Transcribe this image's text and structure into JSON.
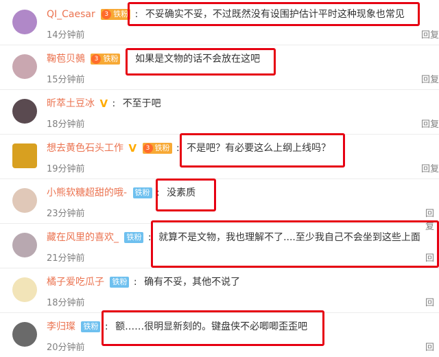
{
  "comments": [
    {
      "user": "QI_Caesar",
      "verified": false,
      "badge": "铁粉",
      "badge_level": "3",
      "badge_style": "gold",
      "text": "不妥确实不妥，不过既然没有设围护估计平时这种现象也常见",
      "time": "14分钟前",
      "reply": "回复",
      "avatar_color": "#b088c8"
    },
    {
      "user": "鞠苞贝鵺",
      "verified": false,
      "badge": "铁粉",
      "badge_level": "3",
      "badge_style": "gold",
      "text": "如果是文物的话不会放在这吧",
      "time": "15分钟前",
      "reply": "回复",
      "avatar_color": "#c9a7b0"
    },
    {
      "user": "昕萃土豆冰",
      "verified": true,
      "badge": "",
      "badge_level": "",
      "badge_style": "",
      "text": "不至于吧",
      "time": "18分钟前",
      "reply": "回复",
      "avatar_color": "#5a4a50"
    },
    {
      "user": "想去黄色石头工作",
      "verified": true,
      "badge": "铁粉",
      "badge_level": "3",
      "badge_style": "gold",
      "text": "不是吧？有必要这么上纲上线吗？",
      "time": "19分钟前",
      "reply": "回复",
      "avatar_color": "#d8a020"
    },
    {
      "user": "小熊软糖超甜的哦-",
      "verified": false,
      "badge": "铁粉",
      "badge_level": "",
      "badge_style": "blue",
      "text": "没素质",
      "time": "23分钟前",
      "reply": "回复",
      "avatar_color": "#e0c8b8"
    },
    {
      "user": "藏在风里的喜欢_",
      "verified": false,
      "badge": "铁粉",
      "badge_level": "",
      "badge_style": "blue",
      "text": "就算不是文物，我也理解不了....至少我自己不会坐到这些上面",
      "time": "21分钟前",
      "reply": "回",
      "avatar_color": "#b8a8b0"
    },
    {
      "user": "橘子爱吃瓜子",
      "verified": false,
      "badge": "铁粉",
      "badge_level": "",
      "badge_style": "blue",
      "text": "确有不妥，其他不说了",
      "time": "18分钟前",
      "reply": "回",
      "avatar_color": "#f2e4b8"
    },
    {
      "user": "李归璨",
      "verified": false,
      "badge": "铁粉",
      "badge_level": "",
      "badge_style": "blue",
      "text": "额……很明显新刻的。键盘侠不必唧唧歪歪吧",
      "time": "20分钟前",
      "reply": "回",
      "avatar_color": "#6a6a6a"
    }
  ],
  "highlight_color": "#e60012"
}
